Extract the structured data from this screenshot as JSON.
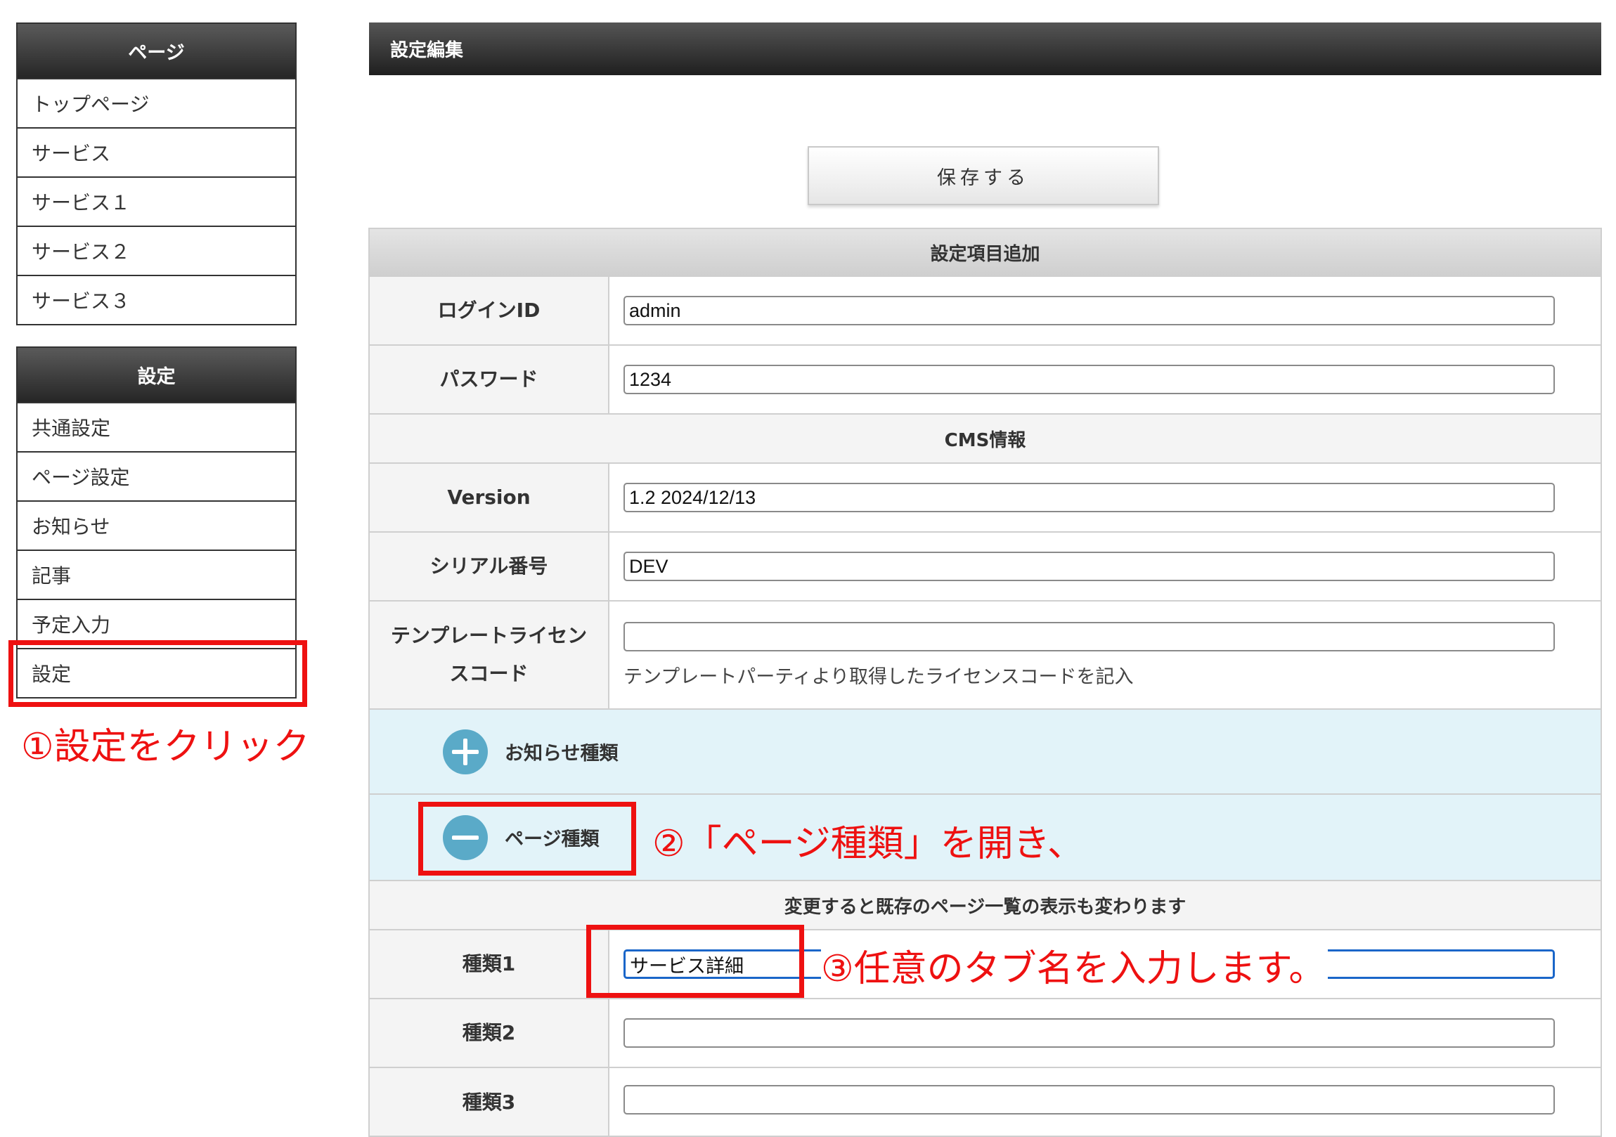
{
  "sidebar": {
    "pages": {
      "title": "ページ",
      "items": [
        "トップページ",
        "サービス",
        "サービス１",
        "サービス２",
        "サービス３"
      ]
    },
    "settings": {
      "title": "設定",
      "items": [
        "共通設定",
        "ページ設定",
        "お知らせ",
        "記事",
        "予定入力",
        "設定"
      ]
    }
  },
  "main": {
    "title": "設定編集",
    "save_label": "保存する",
    "sections": {
      "add": "設定項目追加",
      "cms": "CMS情報",
      "change_note": "変更すると既存のページ一覧の表示も変わります"
    },
    "fields": {
      "login_id": {
        "label": "ログインID",
        "value": "admin"
      },
      "password": {
        "label": "パスワード",
        "value": "1234"
      },
      "version": {
        "label": "Version",
        "value": "1.2 2024/12/13"
      },
      "serial": {
        "label": "シリアル番号",
        "value": "DEV"
      },
      "license": {
        "label_line1": "テンプレートライセン",
        "label_line2": "スコード",
        "value": "",
        "note": "テンプレートパーティより取得したライセンスコードを記入"
      },
      "type1": {
        "label": "種類1",
        "value": "サービス詳細"
      },
      "type2": {
        "label": "種類2",
        "value": ""
      },
      "type3": {
        "label": "種類3",
        "value": ""
      }
    },
    "accordions": {
      "news_types": {
        "label": "お知らせ種類",
        "icon": "plus-icon",
        "expanded": false
      },
      "page_types": {
        "label": "ページ種類",
        "icon": "minus-icon",
        "expanded": true
      }
    }
  },
  "annotations": {
    "step1": "①設定をクリック",
    "step2": "②「ページ種類」を開き、",
    "step3": "③任意のタブ名を入力します。",
    "color": "#ee1111"
  }
}
